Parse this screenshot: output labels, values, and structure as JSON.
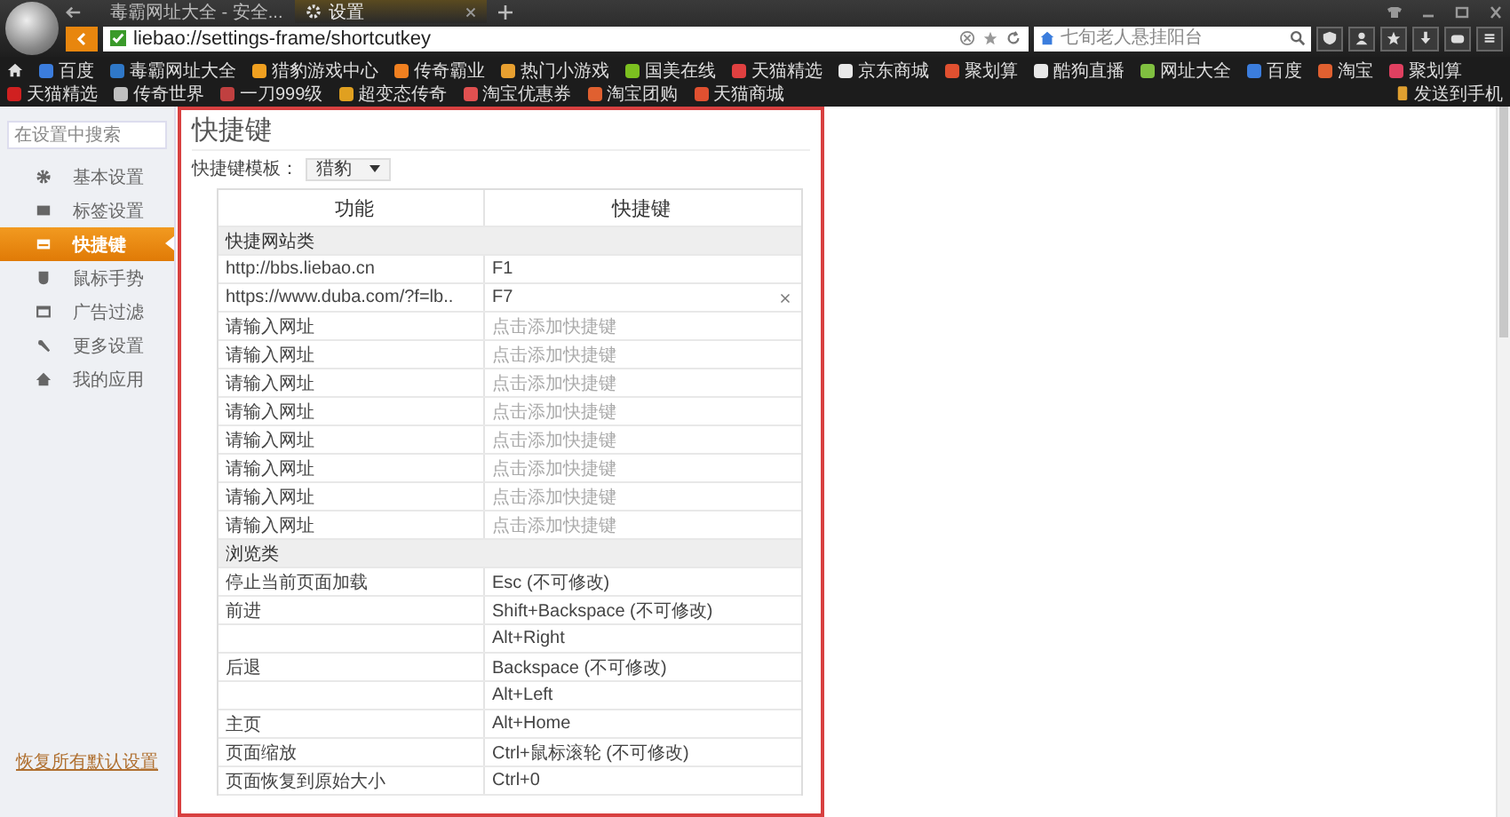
{
  "tabs": [
    {
      "title": "毒霸网址大全 - 安全...",
      "selected": false
    },
    {
      "title": "设置",
      "selected": true
    }
  ],
  "address": {
    "url": "liebao://settings-frame/shortcutkey",
    "search_placeholder": "七旬老人悬挂阳台"
  },
  "bookmarks": [
    {
      "label": "百度",
      "color": "#3b7ddd"
    },
    {
      "label": "毒霸网址大全",
      "color": "#2f78c8"
    },
    {
      "label": "猎豹游戏中心",
      "color": "#f0a020"
    },
    {
      "label": "传奇霸业",
      "color": "#f08020"
    },
    {
      "label": "热门小游戏",
      "color": "#e8a030"
    },
    {
      "label": "国美在线",
      "color": "#7cc020"
    },
    {
      "label": "天猫精选",
      "color": "#e04040"
    },
    {
      "label": "京东商城",
      "color": "#e8e8e8"
    },
    {
      "label": "聚划算",
      "color": "#e05030"
    },
    {
      "label": "酷狗直播",
      "color": "#e8e8e8"
    },
    {
      "label": "网址大全",
      "color": "#80c040"
    },
    {
      "label": "百度",
      "color": "#3b7ddd"
    },
    {
      "label": "淘宝",
      "color": "#e06030"
    },
    {
      "label": "聚划算",
      "color": "#e04060"
    },
    {
      "label": "天猫精选",
      "color": "#d02020"
    },
    {
      "label": "传奇世界",
      "color": "#c0c0c0"
    },
    {
      "label": "一刀999级",
      "color": "#c04040"
    },
    {
      "label": "超变态传奇",
      "color": "#e0a020"
    },
    {
      "label": "淘宝优惠券",
      "color": "#e05050"
    },
    {
      "label": "淘宝团购",
      "color": "#e06030"
    },
    {
      "label": "天猫商城",
      "color": "#e05030"
    }
  ],
  "send_to_phone": "发送到手机",
  "sidebar": {
    "search_placeholder": "在设置中搜索",
    "items": [
      {
        "label": "基本设置",
        "selected": false
      },
      {
        "label": "标签设置",
        "selected": false
      },
      {
        "label": "快捷键",
        "selected": true
      },
      {
        "label": "鼠标手势",
        "selected": false
      },
      {
        "label": "广告过滤",
        "selected": false
      },
      {
        "label": "更多设置",
        "selected": false
      },
      {
        "label": "我的应用",
        "selected": false
      }
    ],
    "reset_link": "恢复所有默认设置"
  },
  "page": {
    "title": "快捷键",
    "template_label": "快捷键模板：",
    "template_value": "猎豹",
    "columns": [
      "功能",
      "快捷键"
    ],
    "rows": [
      {
        "kind": "category",
        "label": "快捷网站类"
      },
      {
        "kind": "entry",
        "function": "http://bbs.liebao.cn",
        "shortcut": "F1",
        "clearable": false
      },
      {
        "kind": "entry",
        "function": "https://www.duba.com/?f=lb..",
        "shortcut": "F7",
        "clearable": true
      },
      {
        "kind": "entry",
        "function": "请输入网址",
        "placeholder": "点击添加快捷键",
        "clearable": false
      },
      {
        "kind": "entry",
        "function": "请输入网址",
        "placeholder": "点击添加快捷键",
        "clearable": false
      },
      {
        "kind": "entry",
        "function": "请输入网址",
        "placeholder": "点击添加快捷键",
        "clearable": false
      },
      {
        "kind": "entry",
        "function": "请输入网址",
        "placeholder": "点击添加快捷键",
        "clearable": false
      },
      {
        "kind": "entry",
        "function": "请输入网址",
        "placeholder": "点击添加快捷键",
        "clearable": false
      },
      {
        "kind": "entry",
        "function": "请输入网址",
        "placeholder": "点击添加快捷键",
        "clearable": false
      },
      {
        "kind": "entry",
        "function": "请输入网址",
        "placeholder": "点击添加快捷键",
        "clearable": false
      },
      {
        "kind": "entry",
        "function": "请输入网址",
        "placeholder": "点击添加快捷键",
        "clearable": false
      },
      {
        "kind": "category",
        "label": "浏览类"
      },
      {
        "kind": "entry",
        "function": "停止当前页面加载",
        "shortcut": "Esc (不可修改)",
        "clearable": false
      },
      {
        "kind": "entry",
        "function": "前进",
        "shortcut": "Shift+Backspace (不可修改)",
        "clearable": false
      },
      {
        "kind": "entry",
        "shortcut": "Alt+Right",
        "clearable": false
      },
      {
        "kind": "entry",
        "function": "后退",
        "shortcut": "Backspace (不可修改)",
        "clearable": false
      },
      {
        "kind": "entry",
        "shortcut": "Alt+Left",
        "clearable": false
      },
      {
        "kind": "entry",
        "function": "主页",
        "shortcut": "Alt+Home",
        "clearable": false
      },
      {
        "kind": "entry",
        "function": "页面缩放",
        "shortcut": "Ctrl+鼠标滚轮 (不可修改)",
        "clearable": false
      },
      {
        "kind": "entry",
        "function": "页面恢复到原始大小",
        "shortcut": "Ctrl+0",
        "clearable": false
      }
    ]
  }
}
